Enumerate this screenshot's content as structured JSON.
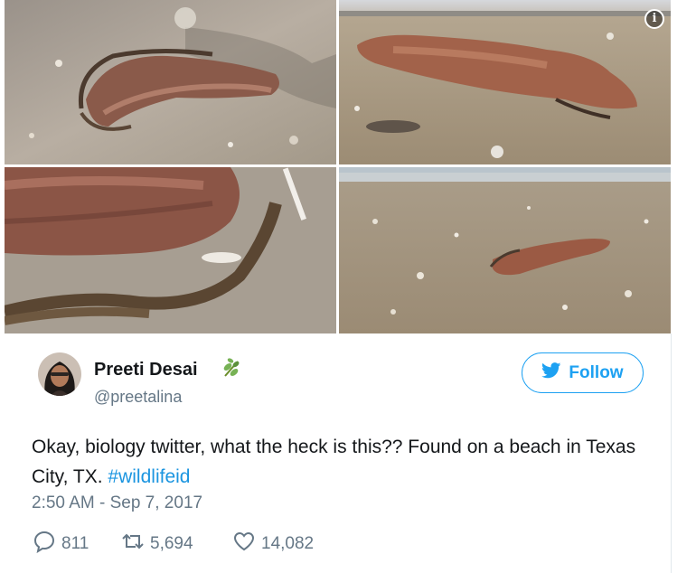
{
  "media": {
    "photos": [
      {
        "name": "photo-creature-top-view"
      },
      {
        "name": "photo-creature-side-view"
      },
      {
        "name": "photo-creature-closeup"
      },
      {
        "name": "photo-creature-beach-wide"
      }
    ],
    "info_icon": "info-icon",
    "info_glyph": "i"
  },
  "author": {
    "display_name": "Preeti Desai",
    "handle": "@preetalina",
    "badge_icon": "seedling-emoji-icon"
  },
  "follow_button": {
    "label": "Follow",
    "icon": "twitter-bird-icon",
    "color": "#1da1f2"
  },
  "tweet": {
    "text": "Okay, biology twitter, what the heck is this?? Found on a beach in Texas City, TX.",
    "hashtag": "#wildlifeid",
    "hashtag_color": "#1b95e0",
    "timestamp": "2:50 AM - Sep 7, 2017"
  },
  "actions": {
    "replies": "811",
    "retweets": "5,694",
    "likes": "14,082",
    "icons": [
      "reply-icon",
      "retweet-icon",
      "heart-icon"
    ],
    "muted_color": "#657786"
  }
}
